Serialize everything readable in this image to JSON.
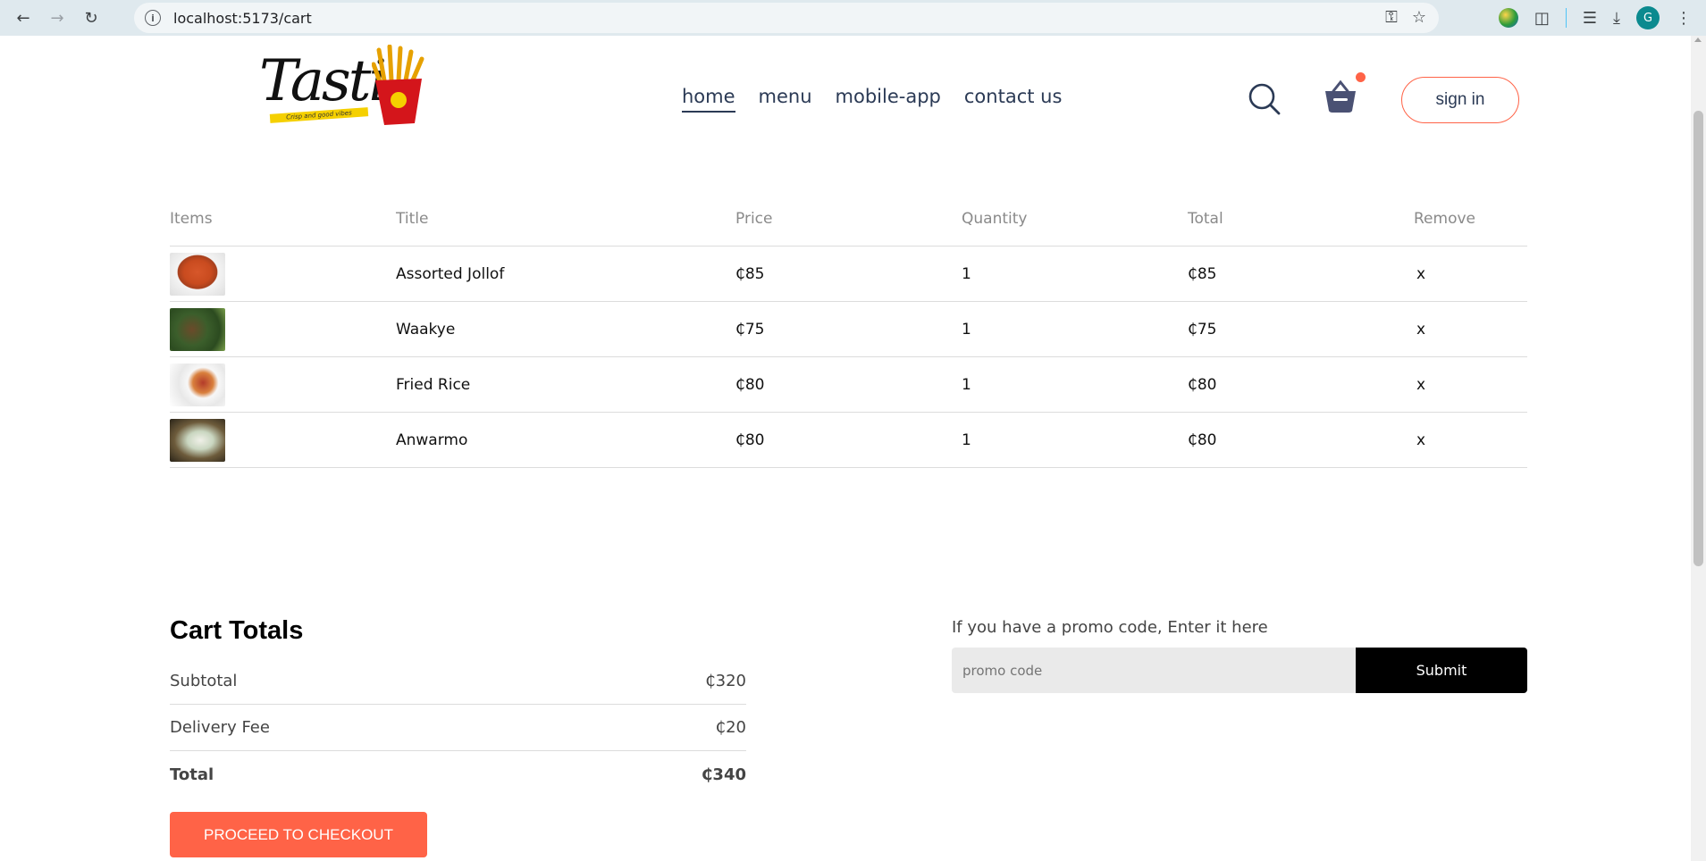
{
  "browser": {
    "url": "localhost:5173/cart",
    "profile_initial": "G"
  },
  "header": {
    "logo_text": "Tasti",
    "logo_tagline": "Crisp and good vibes",
    "nav": [
      {
        "label": "home",
        "active": true
      },
      {
        "label": "menu",
        "active": false
      },
      {
        "label": "mobile-app",
        "active": false
      },
      {
        "label": "contact us",
        "active": false
      }
    ],
    "signin_label": "sign in",
    "accent_color": "#ff6347"
  },
  "cart": {
    "columns": [
      "Items",
      "Title",
      "Price",
      "Quantity",
      "Total",
      "Remove"
    ],
    "rows": [
      {
        "title": "Assorted Jollof",
        "price": "₵85",
        "quantity": "1",
        "total": "₵85",
        "remove": "x"
      },
      {
        "title": "Waakye",
        "price": "₵75",
        "quantity": "1",
        "total": "₵75",
        "remove": "x"
      },
      {
        "title": "Fried Rice",
        "price": "₵80",
        "quantity": "1",
        "total": "₵80",
        "remove": "x"
      },
      {
        "title": "Anwarmo",
        "price": "₵80",
        "quantity": "1",
        "total": "₵80",
        "remove": "x"
      }
    ]
  },
  "totals": {
    "heading": "Cart Totals",
    "subtotal_label": "Subtotal",
    "subtotal_value": "₵320",
    "delivery_label": "Delivery Fee",
    "delivery_value": "₵20",
    "total_label": "Total",
    "total_value": "₵340",
    "checkout_label": "PROCEED TO CHECKOUT"
  },
  "promo": {
    "prompt": "If you have a promo code, Enter it here",
    "placeholder": "promo code",
    "submit_label": "Submit"
  }
}
